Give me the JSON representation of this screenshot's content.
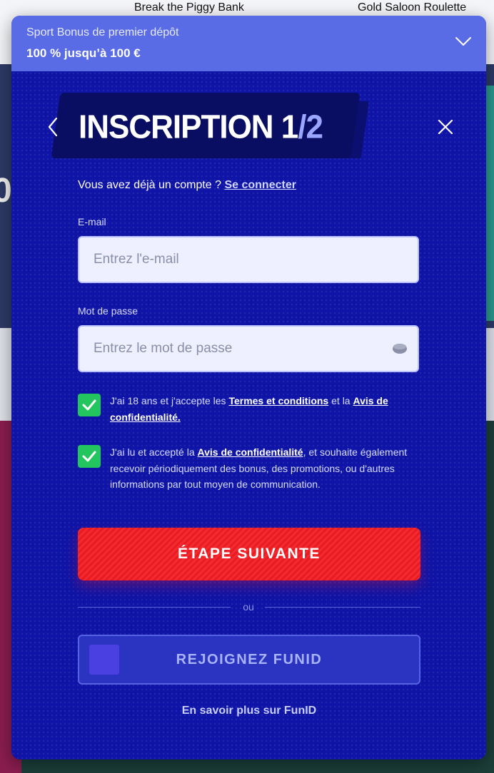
{
  "background": {
    "captions": [
      "Break the Piggy Bank",
      "Gold Saloon Roulette"
    ],
    "edge_letter": "0"
  },
  "bonus": {
    "subtitle": "Sport Bonus de premier dépôt",
    "amount": "100 % jusqu’à 100 €"
  },
  "header": {
    "title_main": "INSCRIPTION 1",
    "title_total": "/2"
  },
  "login_prompt": {
    "text": "Vous avez déjà un compte ? ",
    "link": "Se connecter"
  },
  "form": {
    "email_label": "E-mail",
    "email_placeholder": "Entrez l'e-mail",
    "email_value": "",
    "password_label": "Mot de passe",
    "password_placeholder": "Entrez le mot de passe",
    "password_value": ""
  },
  "consents": [
    {
      "checked": true,
      "before": "J'ai 18 ans et j'accepte les ",
      "link1": "Termes et conditions",
      "middle": " et la ",
      "link2": "Avis de confidentialité."
    },
    {
      "checked": true,
      "before": "J'ai lu et accepté la ",
      "link1": "Avis de confidentialité",
      "after": ", et souhaite également recevoir périodiquement des bonus, des promotions, ou d'autres informations par tout moyen de communication."
    }
  ],
  "actions": {
    "next_label": "ÉTAPE SUIVANTE",
    "or_label": "ou",
    "funid_label": "REJOIGNEZ FUNID",
    "learn_more": "En savoir plus sur FunID"
  },
  "colors": {
    "modal_bg": "#0f14a6",
    "bonus_bar": "#5a6be6",
    "primary_button": "#e81a22",
    "checkbox": "#22c55e"
  }
}
